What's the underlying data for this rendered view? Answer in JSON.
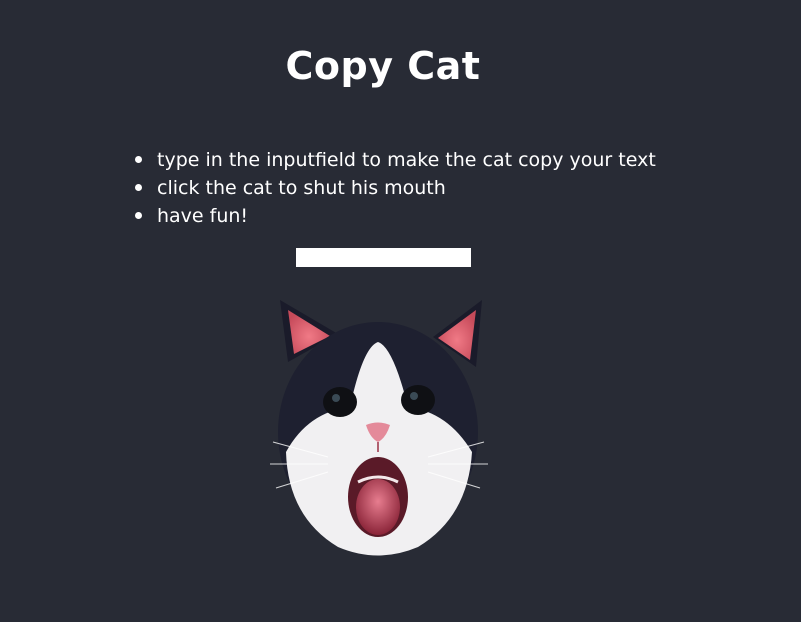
{
  "header": {
    "title": "Copy Cat"
  },
  "instructions": {
    "items": [
      "type in the inputfield to make the cat copy your text",
      "click the cat to shut his mouth",
      "have fun!"
    ]
  },
  "input": {
    "value": "",
    "placeholder": ""
  },
  "cat": {
    "icon": "cat-face-icon",
    "mouth_state": "open"
  },
  "colors": {
    "background": "#282b35",
    "text": "#ffffff",
    "input_background": "#ffffff"
  }
}
